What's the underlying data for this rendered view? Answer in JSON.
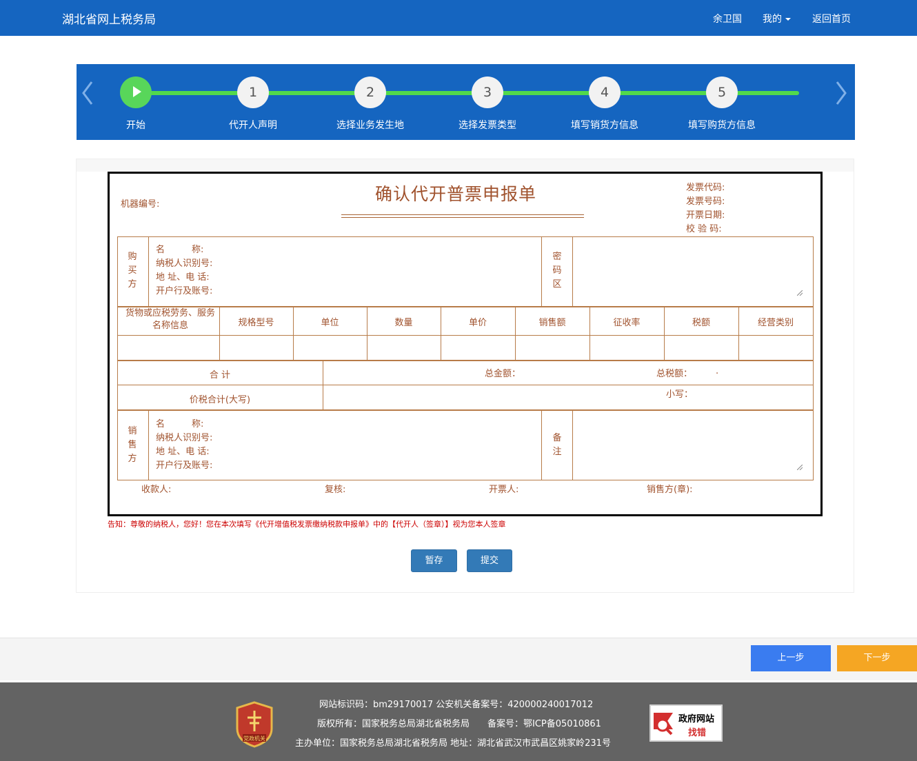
{
  "header": {
    "brand": "湖北省网上税务局",
    "user": "余卫国",
    "mine": "我的",
    "home": "返回首页"
  },
  "stepper": {
    "steps": [
      {
        "num": "",
        "label": "开始",
        "active": true
      },
      {
        "num": "1",
        "label": "代开人声明"
      },
      {
        "num": "2",
        "label": "选择业务发生地"
      },
      {
        "num": "3",
        "label": "选择发票类型"
      },
      {
        "num": "4",
        "label": "填写销货方信息"
      },
      {
        "num": "5",
        "label": "填写购货方信息"
      }
    ]
  },
  "form": {
    "title": "确认代开普票申报单",
    "machine_no": "机器编号:",
    "meta": {
      "code": "发票代码:",
      "number": "发票号码:",
      "date": "开票日期:",
      "check": "校 验 码:"
    },
    "buyer": {
      "side": "购买方",
      "name": "名　　　称:",
      "taxid": "纳税人识别号:",
      "addr": "地 址、电 话:",
      "bank": "开户行及账号:",
      "cipher": "密码区"
    },
    "columns": [
      "货物或应税劳务、服务名称信息",
      "规格型号",
      "单位",
      "数量",
      "单价",
      "销售额",
      "征收率",
      "税额",
      "经营类别"
    ],
    "total_label": "合 计",
    "total_amount": "总金额：",
    "total_tax": "总税额：",
    "total_tax_value": ".",
    "price_tax_label": "价税合计(大写)",
    "small": "小写：",
    "seller": {
      "side": "销售方",
      "name": "名　　　称:",
      "taxid": "纳税人识别号:",
      "addr": "地 址、电 话:",
      "bank": "开户行及账号:",
      "remark": "备注"
    },
    "footer": {
      "payee": "收款人:",
      "review": "复核:",
      "drawer": "开票人:",
      "seller_seal": "销售方(章):"
    }
  },
  "notice": "告知：尊敬的纳税人，您好！您在本次填写《代开增值税发票缴纳税款申报单》中的【代开人（签章）】视为您本人签章",
  "buttons": {
    "save": "暂存",
    "submit": "提交",
    "prev": "上一步",
    "next": "下一步"
  },
  "footer": {
    "line1": "网站标识码：bm29170017 公安机关备案号：420000240017012",
    "line2": "版权所有：国家税务总局湖北省税务局　　备案号：鄂ICP备05010861",
    "line3": "主办单位：国家税务总局湖北省税务局 地址：湖北省武汉市武昌区姚家岭231号",
    "party_badge": "党政机关",
    "gov_badge_top": "政府网站",
    "gov_badge_bottom": "找错"
  }
}
